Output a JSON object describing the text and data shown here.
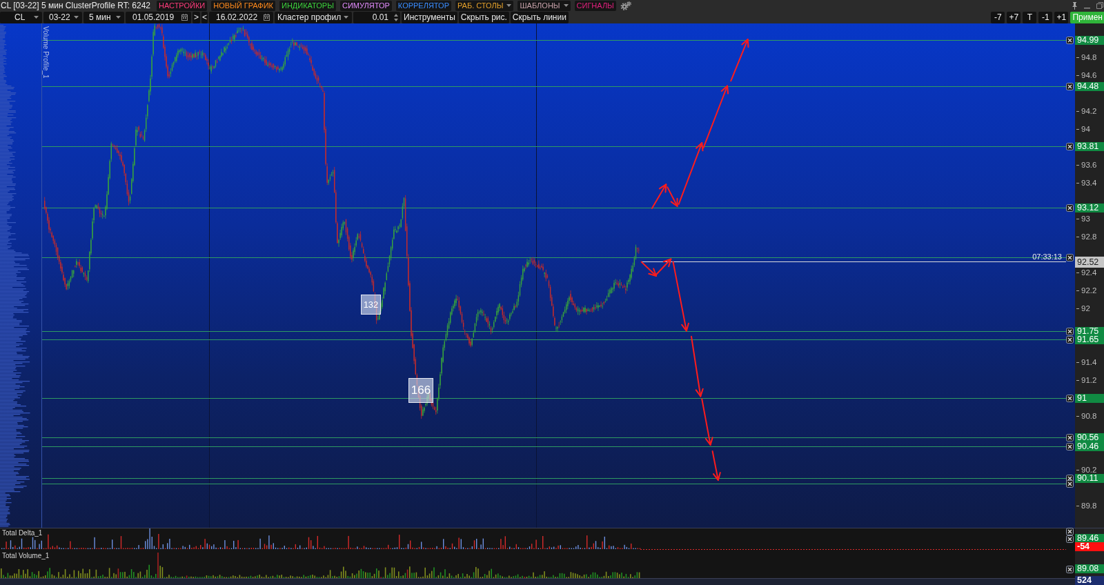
{
  "window": {
    "title": "CL [03-22] 5 мин ClusterProfile RT: 6242"
  },
  "menu": [
    {
      "label": "НАСТРОЙКИ",
      "color": "#ff3b7b",
      "has_menu": false
    },
    {
      "label": "НОВЫЙ ГРАФИК",
      "color": "#ff8a1c",
      "has_menu": false
    },
    {
      "label": "ИНДИКАТОРЫ",
      "color": "#3cd23c",
      "has_menu": false
    },
    {
      "label": "СИМУЛЯТОР",
      "color": "#e48dff",
      "has_menu": false
    },
    {
      "label": "КОРРЕЛЯТОР",
      "color": "#3a8dff",
      "has_menu": false
    },
    {
      "label": "РАБ. СТОЛЫ",
      "color": "#e6a22c",
      "has_menu": true
    },
    {
      "label": "ШАБЛОНЫ",
      "color": "#c8a2aa",
      "has_menu": true
    },
    {
      "label": "СИГНАЛЫ",
      "color": "#e0207c",
      "has_menu": false
    }
  ],
  "toolbar": {
    "items": [
      {
        "kind": "dropdown",
        "text": "CL"
      },
      {
        "kind": "dropdown",
        "text": "03-22"
      },
      {
        "kind": "dropdown",
        "text": "5 мин"
      },
      {
        "kind": "date",
        "text": "01.05.2019"
      },
      {
        "kind": "button",
        "text": ">"
      },
      {
        "kind": "button",
        "text": "<"
      },
      {
        "kind": "date",
        "text": "16.02.2022"
      },
      {
        "kind": "dropdown",
        "text": "Кластер профил"
      },
      {
        "kind": "spinner",
        "text": "0.01"
      },
      {
        "kind": "button",
        "text": "Инструменты"
      },
      {
        "kind": "button",
        "text": "Скрыть рис."
      },
      {
        "kind": "button",
        "text": "Скрыть линии"
      }
    ],
    "step_buttons": [
      "-7",
      "+7",
      "T",
      "-1",
      "+1"
    ],
    "apply_button": "Примен"
  },
  "chart": {
    "indicator": "Volume Profile_1",
    "price_lines": [
      {
        "label": "94.99",
        "doubled": false
      },
      {
        "label": "94.48",
        "doubled": false
      },
      {
        "label": "93.81",
        "doubled": false
      },
      {
        "label": "93.12",
        "doubled": false
      },
      {
        "label": "91.75",
        "doubled": false
      },
      {
        "label": "91.65",
        "doubled": false
      },
      {
        "label": "91",
        "doubled": false
      },
      {
        "label": "90.56",
        "doubled": false
      },
      {
        "label": "90.46",
        "doubled": false
      },
      {
        "label": "90.11",
        "doubled": true
      }
    ],
    "current_price": {
      "label": "92.52",
      "time": "07:33:13"
    },
    "axis_ticks": [
      "94.8",
      "94.6",
      "94.2",
      "94",
      "93.6",
      "93.4",
      "93",
      "92.8",
      "92.4",
      "92.2",
      "92",
      "91.4",
      "91.2",
      "90.8",
      "90.2",
      "89.8"
    ],
    "markers": [
      {
        "text": "132"
      },
      {
        "text": "166"
      }
    ]
  },
  "panels": [
    {
      "kind": "delta",
      "title": "Total Delta_1",
      "line_tag": {
        "label": "89.46",
        "doubled": true
      },
      "value": "-54"
    },
    {
      "kind": "volume",
      "title": "Total Volume_1",
      "line_tag": {
        "label": "89.08",
        "doubled": false
      },
      "value": "524"
    }
  ]
}
